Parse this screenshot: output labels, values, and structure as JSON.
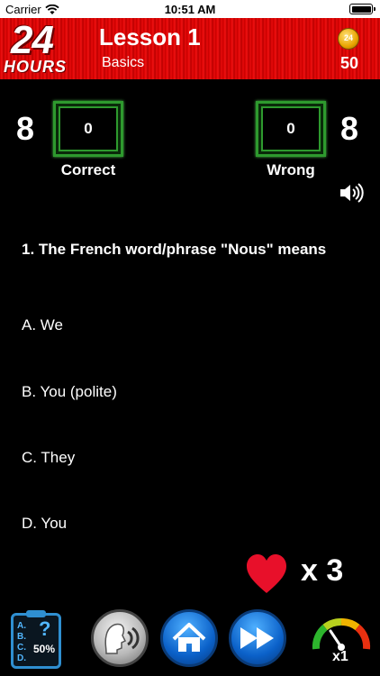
{
  "status_bar": {
    "carrier": "Carrier",
    "time": "10:51 AM"
  },
  "header": {
    "logo_number": "24",
    "logo_word": "HOURS",
    "lesson_title": "Lesson 1",
    "lesson_subtitle": "Basics",
    "coin_count": "50"
  },
  "score": {
    "correct_remaining": "8",
    "correct_count": "0",
    "correct_label": "Correct",
    "wrong_count": "0",
    "wrong_remaining": "8",
    "wrong_label": "Wrong"
  },
  "question": {
    "text": "1. The French word/phrase \"Nous\" means",
    "options": [
      {
        "label": "A. We"
      },
      {
        "label": "B. You (polite)"
      },
      {
        "label": "C. They"
      },
      {
        "label": "D. You"
      }
    ]
  },
  "lives": {
    "label": "x 3"
  },
  "toolbar": {
    "hint_letters": "A.\nB.\nC.\nD.",
    "hint_mark": "?",
    "hint_percent": "50%",
    "speed_label": "x1"
  },
  "colors": {
    "header_red": "#e00000",
    "score_box_green": "#2e9a2e",
    "heart_red": "#e8102a",
    "button_blue": "#0b61c9"
  }
}
